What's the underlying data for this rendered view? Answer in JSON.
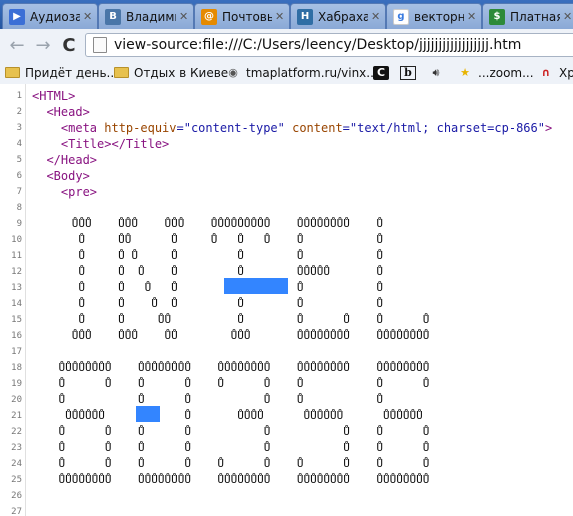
{
  "tabs": [
    {
      "title": "Аудиоза",
      "icon": "video-play-icon",
      "color": "#3b6fd6",
      "glyph": "▶"
    },
    {
      "title": "Владими",
      "icon": "vk-icon",
      "color": "#4a76a8",
      "glyph": "B"
    },
    {
      "title": "Почтовь",
      "icon": "mail-icon",
      "color": "#e58a00",
      "glyph": "@"
    },
    {
      "title": "Хабраха",
      "icon": "habr-icon",
      "color": "#2f6ea5",
      "glyph": "H"
    },
    {
      "title": "векторн",
      "icon": "google-icon",
      "color": "#ffffff",
      "glyph": "g"
    },
    {
      "title": "Платная",
      "icon": "terminal-icon",
      "color": "#2d8a3a",
      "glyph": "$"
    }
  ],
  "toolbar": {
    "back": "←",
    "forward": "→",
    "reload": "C",
    "url": "view-source:file:///C:/Users/leency/Desktop/jjjjjjjjjjjjjjjjjj.htm"
  },
  "bookmarks": [
    {
      "label": "Придёт день...",
      "icon": "folder-icon"
    },
    {
      "label": "Отдых в Киеве",
      "icon": "folder-icon"
    },
    {
      "label": "tmaplatform.ru/vinx...",
      "icon": "globe-icon"
    },
    {
      "label": "",
      "icon": "c-logo-icon"
    },
    {
      "label": "",
      "icon": "b-logo-icon"
    },
    {
      "label": "",
      "icon": "speaker-icon"
    },
    {
      "label": "...zoom...",
      "icon": "star-icon"
    },
    {
      "label": "Хр",
      "icon": "magnet-icon"
    }
  ],
  "source": {
    "line_numbers": [
      "1",
      "2",
      "3",
      "4",
      "5",
      "6",
      "7",
      "8",
      "9",
      "10",
      "11",
      "12",
      "13",
      "14",
      "15",
      "16",
      "17",
      "18",
      "19",
      "20",
      "21",
      "22",
      "23",
      "24",
      "25",
      "26",
      "27"
    ],
    "lines": [
      {
        "type": "tag",
        "text": "<HTML>"
      },
      {
        "type": "tag",
        "text": "  <Head>"
      },
      {
        "type": "meta",
        "indent": "    ",
        "tag_open": "<meta ",
        "a1": "http-equiv",
        "v1": "=\"content-type\"",
        "a2": " content",
        "v2": "=\"text/html; charset=cp-866\"",
        "tag_close": ">"
      },
      {
        "type": "tag",
        "text": "    <Title></Title>"
      },
      {
        "type": "tag",
        "text": "  </Head>"
      },
      {
        "type": "tag",
        "text": "  <Body>"
      },
      {
        "type": "tag",
        "text": "    <pre>"
      },
      {
        "type": "art",
        "text": ""
      },
      {
        "type": "art",
        "text": "      ŮŮŮ    ŮŮŮ    ŮŮŮ    ŮŮŮŮŮŮŮŮŮ    ŮŮŮŮŮŮŮŮ    Ů"
      },
      {
        "type": "art",
        "text": "       Ů     ŮŮ      Ů     Ů   Ů   Ů    Ů           Ů"
      },
      {
        "type": "art",
        "text": "       Ů     Ů Ů     Ů         Ů        Ů           Ů"
      },
      {
        "type": "art",
        "text": "       Ů     Ů  Ů    Ů         Ů        ŮŮŮŮŮ       Ů"
      },
      {
        "type": "art",
        "text": "       Ů     Ů   Ů   Ů         Ů        Ů           Ů"
      },
      {
        "type": "art",
        "text": "       Ů     Ů    Ů  Ů         Ů        Ů           Ů"
      },
      {
        "type": "art",
        "text": "       Ů     Ů     ŮŮ          Ů        Ů      Ů    Ů      Ů"
      },
      {
        "type": "art",
        "text": "      ŮŮŮ    ŮŮŮ    ŮŮ        ŮŮŮ       ŮŮŮŮŮŮŮŮ    ŮŮŮŮŮŮŮŮ"
      },
      {
        "type": "art",
        "text": ""
      },
      {
        "type": "art",
        "text": "    ŮŮŮŮŮŮŮŮ    ŮŮŮŮŮŮŮŮ    ŮŮŮŮŮŮŮŮ    ŮŮŮŮŮŮŮŮ    ŮŮŮŮŮŮŮŮ"
      },
      {
        "type": "art",
        "text": "    Ů      Ů    Ů      Ů    Ů      Ů    Ů           Ů      Ů"
      },
      {
        "type": "art",
        "text": "    Ů           Ů      Ů           Ů    Ů           Ů"
      },
      {
        "type": "art",
        "text": "     ŮŮŮŮŮŮ     Ů      Ů       ŮŮŮŮ      ŮŮŮŮŮŮ      ŮŮŮŮŮŮ"
      },
      {
        "type": "art",
        "text": "    Ů      Ů    Ů      Ů           Ů           Ů    Ů      Ů"
      },
      {
        "type": "art",
        "text": "    Ů      Ů    Ů      Ů           Ů           Ů    Ů      Ů"
      },
      {
        "type": "art",
        "text": "    Ů      Ů    Ů      Ů    Ů      Ů    Ů      Ů    Ů      Ů"
      },
      {
        "type": "art",
        "text": "    ŮŮŮŮŮŮŮŮ    ŮŮŮŮŮŮŮŮ    ŮŮŮŮŮŮŮŮ    ŮŮŮŮŮŮŮŮ    ŮŮŮŮŮŮŮŮ"
      },
      {
        "type": "art",
        "text": ""
      },
      {
        "type": "art",
        "text": ""
      }
    ]
  },
  "colors": {
    "tag": "#881280",
    "attribute": "#994500",
    "value": "#1a1aa6",
    "selection": "#3385ff",
    "tabstrip": "#2d5ea8"
  }
}
